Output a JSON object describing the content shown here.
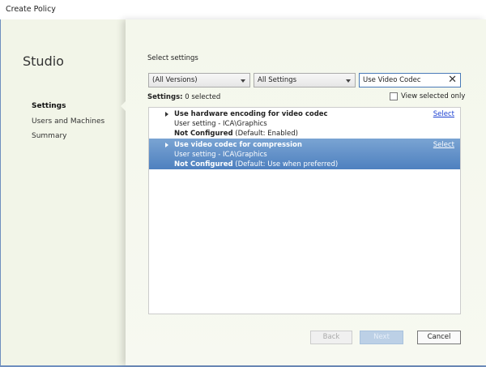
{
  "window": {
    "title": "Create Policy"
  },
  "sidebar": {
    "brand": "Studio",
    "items": [
      {
        "label": "Settings",
        "active": true
      },
      {
        "label": "Users and Machines"
      },
      {
        "label": "Summary"
      }
    ]
  },
  "main": {
    "heading": "Select settings",
    "version_filter": "(All Versions)",
    "category_filter": "All Settings",
    "search_value": "Use Video Codec",
    "settings_label": "Settings:",
    "selected_count": "0 selected",
    "view_selected_only": "View selected only",
    "settings": [
      {
        "name": "Use hardware encoding for video codec",
        "scope": "User setting - ICA\\Graphics",
        "state": "Not Configured",
        "default": "(Default: Enabled)",
        "action": "Select",
        "selected": false
      },
      {
        "name": "Use video codec for compression",
        "scope": "User setting - ICA\\Graphics",
        "state": "Not Configured",
        "default": "(Default: Use when preferred)",
        "action": "Select",
        "selected": true
      }
    ]
  },
  "footer": {
    "back": "Back",
    "next": "Next",
    "cancel": "Cancel"
  }
}
